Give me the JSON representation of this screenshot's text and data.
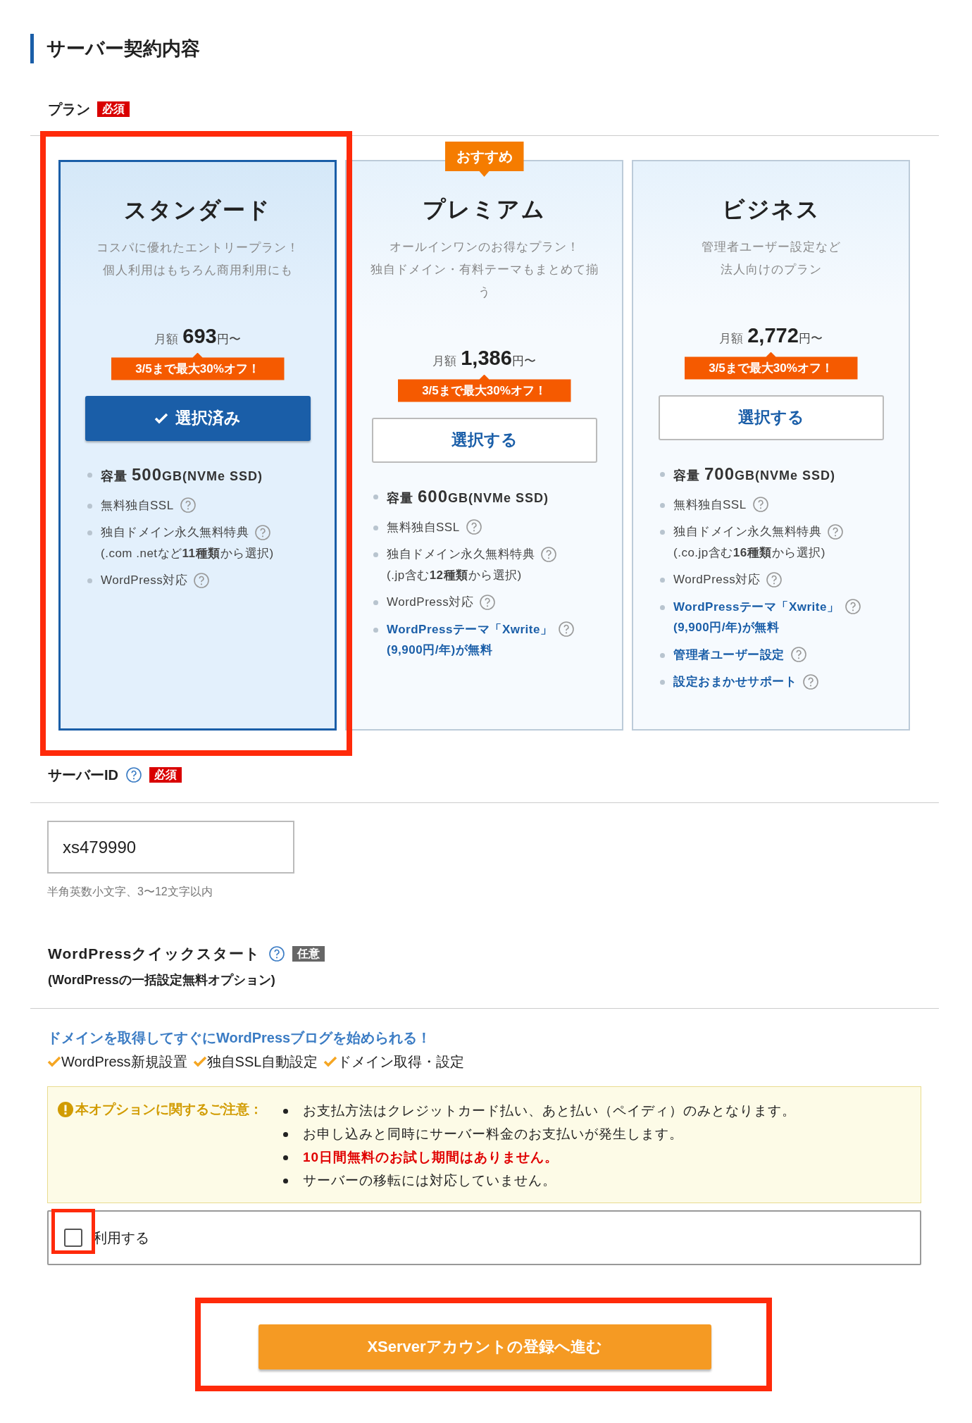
{
  "section_title": "サーバー契約内容",
  "plan_field": {
    "label": "プラン",
    "badge": "必須",
    "required": true
  },
  "plans": [
    {
      "name": "スタンダード",
      "selected": true,
      "description": [
        "コスパに優れたエントリープラン！",
        "個人利用はもちろん商用利用にも"
      ],
      "price_prefix": "月額",
      "price": "693",
      "price_suffix": "円〜",
      "discount": "3/5まで最大30%オフ！",
      "button": "選択済み",
      "features": [
        {
          "kind": "capacity",
          "label": "容量",
          "amount": "500",
          "unit": "GB(NVMe SSD)",
          "help": false
        },
        {
          "kind": "plain",
          "text": "無料独自SSL",
          "help": true
        },
        {
          "kind": "plain",
          "text": "独自ドメイン永久無料特典",
          "note": "(.com .netなど**11種類**から選択)",
          "help": true
        },
        {
          "kind": "plain",
          "text": "WordPress対応",
          "help": true
        }
      ]
    },
    {
      "name": "プレミアム",
      "selected": false,
      "badge": "おすすめ",
      "description": [
        "オールインワンのお得なプラン！",
        "独自ドメイン・有料テーマもまとめて揃",
        "う"
      ],
      "price_prefix": "月額",
      "price": "1,386",
      "price_suffix": "円〜",
      "discount": "3/5まで最大30%オフ！",
      "button": "選択する",
      "features": [
        {
          "kind": "capacity",
          "label": "容量",
          "amount": "600",
          "unit": "GB(NVMe SSD)",
          "help": false
        },
        {
          "kind": "plain",
          "text": "無料独自SSL",
          "help": true
        },
        {
          "kind": "plain",
          "text": "独自ドメイン永久無料特典",
          "note": "(.jp含む**12種類**から選択)",
          "help": true
        },
        {
          "kind": "plain",
          "text": "WordPress対応",
          "help": true
        },
        {
          "kind": "highlight",
          "text": "WordPressテーマ「Xwrite」",
          "note": "(9,900円/年)が無料",
          "help": true
        }
      ]
    },
    {
      "name": "ビジネス",
      "selected": false,
      "description": [
        "管理者ユーザー設定など",
        "法人向けのプラン"
      ],
      "price_prefix": "月額",
      "price": "2,772",
      "price_suffix": "円〜",
      "discount": "3/5まで最大30%オフ！",
      "button": "選択する",
      "features": [
        {
          "kind": "capacity",
          "label": "容量",
          "amount": "700",
          "unit": "GB(NVMe SSD)",
          "help": false
        },
        {
          "kind": "plain",
          "text": "無料独自SSL",
          "help": true
        },
        {
          "kind": "plain",
          "text": "独自ドメイン永久無料特典",
          "note": "(.co.jp含む**16種類**から選択)",
          "help": true
        },
        {
          "kind": "plain",
          "text": "WordPress対応",
          "help": true
        },
        {
          "kind": "highlight",
          "text": "WordPressテーマ「Xwrite」",
          "note": "(9,900円/年)が無料",
          "help": true
        },
        {
          "kind": "highlight",
          "text": "管理者ユーザー設定",
          "help": true
        },
        {
          "kind": "highlight",
          "text": "設定おまかせサポート",
          "help": true
        }
      ]
    }
  ],
  "server_id": {
    "label": "サーバーID",
    "badge": "必須",
    "required": true,
    "value": "xs479990",
    "hint": "半角英数小文字、3〜12文字以内"
  },
  "quick_start": {
    "label": "WordPressクイックスタート",
    "badge": "任意",
    "required": false,
    "subtitle": "(WordPressの一括設定無料オプション)",
    "headline": "ドメインを取得してすぐにWordPressブログを始められる！",
    "checks": [
      "WordPress新規設置",
      "独自SSL自動設定",
      "ドメイン取得・設定"
    ],
    "notice": {
      "title": "本オプションに関するご注意：",
      "items": [
        {
          "text": "お支払方法はクレジットカード払い、あと払い（ペイディ）のみとなります。",
          "emphasis": false
        },
        {
          "text": "お申し込みと同時にサーバー料金のお支払いが発生します。",
          "emphasis": false
        },
        {
          "text": "10日間無料のお試し期間はありません。",
          "emphasis": true
        },
        {
          "text": "サーバーの移転には対応していません。",
          "emphasis": false
        }
      ]
    },
    "option": {
      "label": "利用する",
      "checked": false
    }
  },
  "submit_button": "XServerアカウントの登録へ進む"
}
